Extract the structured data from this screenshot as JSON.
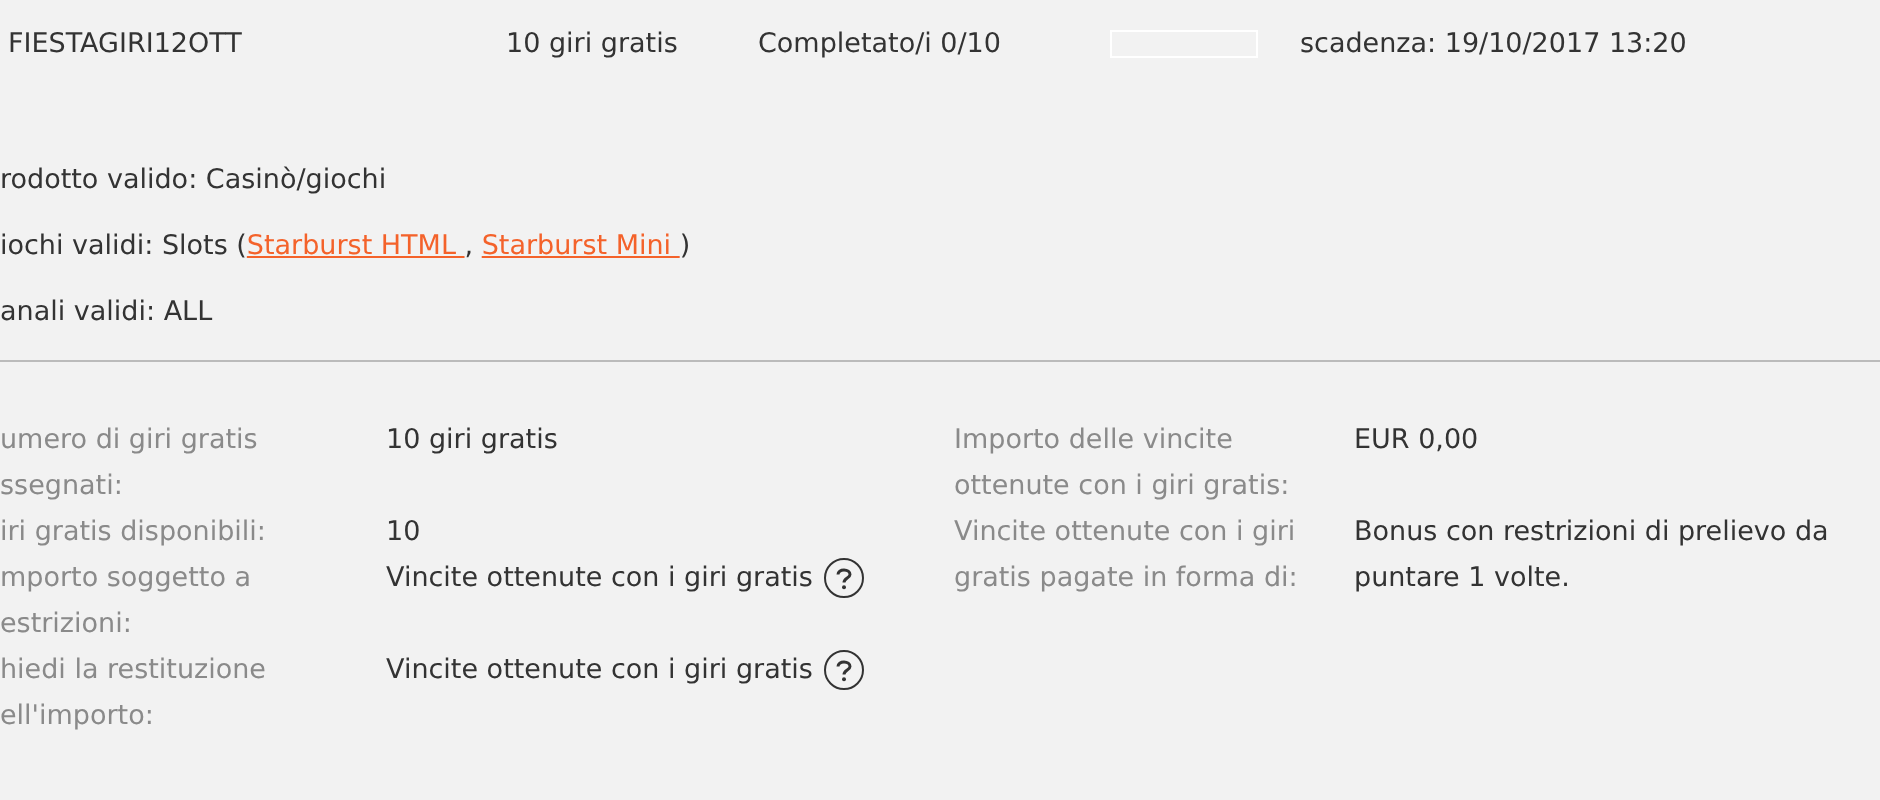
{
  "summary": {
    "code": "FIESTAGIRI12OTT",
    "spins": "10 giri gratis",
    "completed": "Completato/i 0/10",
    "progress": {
      "level": 0
    },
    "expiry": "scadenza: 19/10/2017 13:20"
  },
  "info": [
    {
      "text": "rodotto valido: Casinò/giochi"
    },
    {
      "text": "iochi validi: Slots (",
      "links": [
        "Starburst HTML ",
        "Starburst Mini "
      ],
      "separator": ",",
      "close": ")"
    },
    {
      "text": "anali validi: ALL"
    }
  ],
  "details_left": [
    {
      "label": "umero di giri gratis ssegnati:",
      "value": "10 giri gratis",
      "help": false
    },
    {
      "label": "iri gratis disponibili:",
      "value": "10",
      "help": false
    },
    {
      "label": "mporto soggetto a estrizioni:",
      "value": "Vincite ottenute con i giri gratis",
      "help": true
    },
    {
      "label": "hiedi la restituzione ell'importo:",
      "value": "Vincite ottenute con i giri gratis",
      "help": true
    }
  ],
  "details_right": [
    {
      "label": "Importo delle vincite ottenute con i giri gratis:",
      "value": "EUR 0,00",
      "help": false
    },
    {
      "label": "Vincite ottenute con i giri gratis pagate in forma di:",
      "value": "Bonus con restrizioni di prelievo da puntare 1 volte.",
      "help": false
    }
  ]
}
